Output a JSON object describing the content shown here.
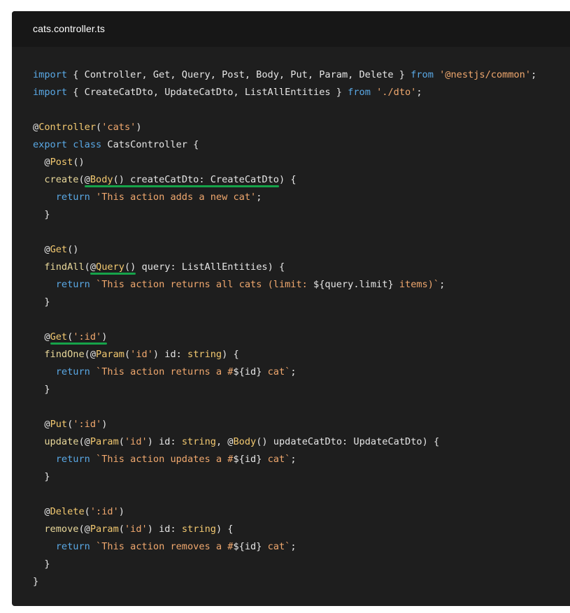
{
  "window": {
    "filename": "cats.controller.ts"
  },
  "colors": {
    "plain": "#e6e6e6",
    "keyword": "#5aa9e6",
    "string": "#f0a86e",
    "decorator": "#f3c970",
    "func": "#e9d89a",
    "type": "#f3c970",
    "punct": "#e6e6e6",
    "underline": "#16a34a"
  },
  "code": {
    "lines": [
      [
        {
          "t": "import",
          "c": "keyword"
        },
        {
          "t": " { Controller, Get, Query, Post, Body, Put, Param, Delete } ",
          "c": "plain"
        },
        {
          "t": "from",
          "c": "keyword"
        },
        {
          "t": " ",
          "c": "plain"
        },
        {
          "t": "'@nestjs/common'",
          "c": "string"
        },
        {
          "t": ";",
          "c": "plain"
        }
      ],
      [
        {
          "t": "import",
          "c": "keyword"
        },
        {
          "t": " { CreateCatDto, UpdateCatDto, ListAllEntities } ",
          "c": "plain"
        },
        {
          "t": "from",
          "c": "keyword"
        },
        {
          "t": " ",
          "c": "plain"
        },
        {
          "t": "'./dto'",
          "c": "string"
        },
        {
          "t": ";",
          "c": "plain"
        }
      ],
      [],
      [
        {
          "t": "@",
          "c": "plain"
        },
        {
          "t": "Controller",
          "c": "decorator"
        },
        {
          "t": "(",
          "c": "plain"
        },
        {
          "t": "'cats'",
          "c": "string"
        },
        {
          "t": ")",
          "c": "plain"
        }
      ],
      [
        {
          "t": "export",
          "c": "keyword"
        },
        {
          "t": " ",
          "c": "plain"
        },
        {
          "t": "class",
          "c": "keyword"
        },
        {
          "t": " CatsController {",
          "c": "plain"
        }
      ],
      [
        {
          "t": "  @",
          "c": "plain"
        },
        {
          "t": "Post",
          "c": "decorator"
        },
        {
          "t": "()",
          "c": "plain"
        }
      ],
      [
        {
          "t": "  ",
          "c": "plain"
        },
        {
          "t": "create",
          "c": "func"
        },
        {
          "t": "(@",
          "c": "plain"
        },
        {
          "t": "Body",
          "c": "decorator"
        },
        {
          "t": "() createCatDto: CreateCatDto) {",
          "c": "plain"
        }
      ],
      [
        {
          "t": "    ",
          "c": "plain"
        },
        {
          "t": "return",
          "c": "keyword"
        },
        {
          "t": " ",
          "c": "plain"
        },
        {
          "t": "'This action adds a new cat'",
          "c": "string"
        },
        {
          "t": ";",
          "c": "plain"
        }
      ],
      [
        {
          "t": "  }",
          "c": "plain"
        }
      ],
      [],
      [
        {
          "t": "  @",
          "c": "plain"
        },
        {
          "t": "Get",
          "c": "decorator"
        },
        {
          "t": "()",
          "c": "plain"
        }
      ],
      [
        {
          "t": "  ",
          "c": "plain"
        },
        {
          "t": "findAll",
          "c": "func"
        },
        {
          "t": "(@",
          "c": "plain"
        },
        {
          "t": "Query",
          "c": "decorator"
        },
        {
          "t": "() query: ListAllEntities) {",
          "c": "plain"
        }
      ],
      [
        {
          "t": "    ",
          "c": "plain"
        },
        {
          "t": "return",
          "c": "keyword"
        },
        {
          "t": " ",
          "c": "plain"
        },
        {
          "t": "`This action returns all cats (limit: ",
          "c": "string"
        },
        {
          "t": "${",
          "c": "plain"
        },
        {
          "t": "query.limit",
          "c": "plain"
        },
        {
          "t": "}",
          "c": "plain"
        },
        {
          "t": " items)`",
          "c": "string"
        },
        {
          "t": ";",
          "c": "plain"
        }
      ],
      [
        {
          "t": "  }",
          "c": "plain"
        }
      ],
      [],
      [
        {
          "t": "  @",
          "c": "plain"
        },
        {
          "t": "Get",
          "c": "decorator"
        },
        {
          "t": "(",
          "c": "plain"
        },
        {
          "t": "':id'",
          "c": "string"
        },
        {
          "t": ")",
          "c": "plain"
        }
      ],
      [
        {
          "t": "  ",
          "c": "plain"
        },
        {
          "t": "findOne",
          "c": "func"
        },
        {
          "t": "(@",
          "c": "plain"
        },
        {
          "t": "Param",
          "c": "decorator"
        },
        {
          "t": "(",
          "c": "plain"
        },
        {
          "t": "'id'",
          "c": "string"
        },
        {
          "t": ") id: ",
          "c": "plain"
        },
        {
          "t": "string",
          "c": "type"
        },
        {
          "t": ") {",
          "c": "plain"
        }
      ],
      [
        {
          "t": "    ",
          "c": "plain"
        },
        {
          "t": "return",
          "c": "keyword"
        },
        {
          "t": " ",
          "c": "plain"
        },
        {
          "t": "`This action returns a #",
          "c": "string"
        },
        {
          "t": "${",
          "c": "plain"
        },
        {
          "t": "id",
          "c": "plain"
        },
        {
          "t": "}",
          "c": "plain"
        },
        {
          "t": " cat`",
          "c": "string"
        },
        {
          "t": ";",
          "c": "plain"
        }
      ],
      [
        {
          "t": "  }",
          "c": "plain"
        }
      ],
      [],
      [
        {
          "t": "  @",
          "c": "plain"
        },
        {
          "t": "Put",
          "c": "decorator"
        },
        {
          "t": "(",
          "c": "plain"
        },
        {
          "t": "':id'",
          "c": "string"
        },
        {
          "t": ")",
          "c": "plain"
        }
      ],
      [
        {
          "t": "  ",
          "c": "plain"
        },
        {
          "t": "update",
          "c": "func"
        },
        {
          "t": "(@",
          "c": "plain"
        },
        {
          "t": "Param",
          "c": "decorator"
        },
        {
          "t": "(",
          "c": "plain"
        },
        {
          "t": "'id'",
          "c": "string"
        },
        {
          "t": ") id: ",
          "c": "plain"
        },
        {
          "t": "string",
          "c": "type"
        },
        {
          "t": ", @",
          "c": "plain"
        },
        {
          "t": "Body",
          "c": "decorator"
        },
        {
          "t": "() updateCatDto: UpdateCatDto) {",
          "c": "plain"
        }
      ],
      [
        {
          "t": "    ",
          "c": "plain"
        },
        {
          "t": "return",
          "c": "keyword"
        },
        {
          "t": " ",
          "c": "plain"
        },
        {
          "t": "`This action updates a #",
          "c": "string"
        },
        {
          "t": "${",
          "c": "plain"
        },
        {
          "t": "id",
          "c": "plain"
        },
        {
          "t": "}",
          "c": "plain"
        },
        {
          "t": " cat`",
          "c": "string"
        },
        {
          "t": ";",
          "c": "plain"
        }
      ],
      [
        {
          "t": "  }",
          "c": "plain"
        }
      ],
      [],
      [
        {
          "t": "  @",
          "c": "plain"
        },
        {
          "t": "Delete",
          "c": "decorator"
        },
        {
          "t": "(",
          "c": "plain"
        },
        {
          "t": "':id'",
          "c": "string"
        },
        {
          "t": ")",
          "c": "plain"
        }
      ],
      [
        {
          "t": "  ",
          "c": "plain"
        },
        {
          "t": "remove",
          "c": "func"
        },
        {
          "t": "(@",
          "c": "plain"
        },
        {
          "t": "Param",
          "c": "decorator"
        },
        {
          "t": "(",
          "c": "plain"
        },
        {
          "t": "'id'",
          "c": "string"
        },
        {
          "t": ") id: ",
          "c": "plain"
        },
        {
          "t": "string",
          "c": "type"
        },
        {
          "t": ") {",
          "c": "plain"
        }
      ],
      [
        {
          "t": "    ",
          "c": "plain"
        },
        {
          "t": "return",
          "c": "keyword"
        },
        {
          "t": " ",
          "c": "plain"
        },
        {
          "t": "`This action removes a #",
          "c": "string"
        },
        {
          "t": "${",
          "c": "plain"
        },
        {
          "t": "id",
          "c": "plain"
        },
        {
          "t": "}",
          "c": "plain"
        },
        {
          "t": " cat`",
          "c": "string"
        },
        {
          "t": ";",
          "c": "plain"
        }
      ],
      [
        {
          "t": "  }",
          "c": "plain"
        }
      ],
      [
        {
          "t": "}",
          "c": "plain"
        }
      ]
    ],
    "highlights": [
      {
        "line": 6,
        "text": "@Body() createCatDto: CreateCatDto"
      },
      {
        "line": 11,
        "text": "@Query()"
      },
      {
        "line": 15,
        "text": "Get(':id')"
      }
    ]
  }
}
